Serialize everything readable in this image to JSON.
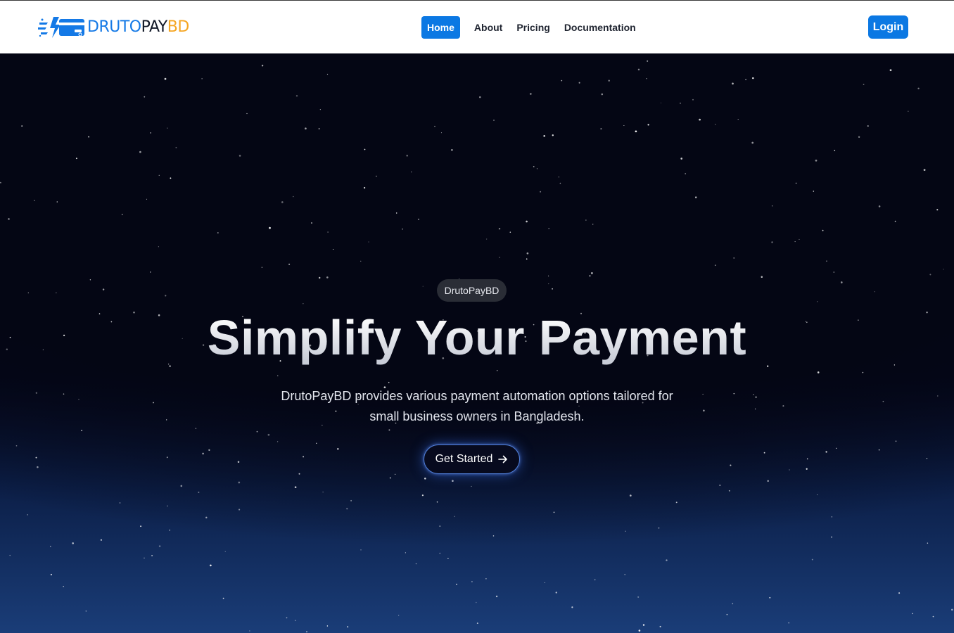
{
  "brand": {
    "part1": "DRUTO",
    "part2": "PAY",
    "part3": "BD",
    "icon": "lightning-card-icon",
    "colors": {
      "primary": "#1479e6",
      "dark": "#111827",
      "accent": "#f5a623"
    }
  },
  "nav": {
    "items": [
      {
        "label": "Home",
        "active": true
      },
      {
        "label": "About",
        "active": false
      },
      {
        "label": "Pricing",
        "active": false
      },
      {
        "label": "Documentation",
        "active": false
      }
    ],
    "login_label": "Login"
  },
  "hero": {
    "badge": "DrutoPayBD",
    "headline": "Simplify Your Payment",
    "subtitle_line1": "DrutoPayBD provides various payment automation options tailored for",
    "subtitle_line2": "small business owners in Bangladesh.",
    "cta_label": "Get Started",
    "cta_icon": "arrow-right-icon"
  },
  "colors": {
    "button": "#0b78e3",
    "sky_top": "#04051a",
    "sky_bottom": "#1a3d78",
    "glow": "#4f7dd6"
  }
}
